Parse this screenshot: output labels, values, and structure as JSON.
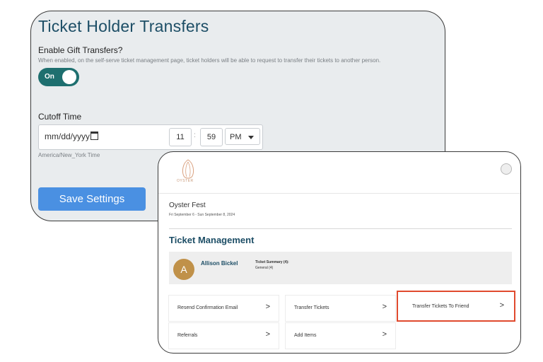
{
  "settings": {
    "title": "Ticket Holder Transfers",
    "enable_label": "Enable Gift Transfers?",
    "enable_help": "When enabled, on the self-serve ticket management page, ticket holders will be able to request to transfer their tickets to another person.",
    "toggle_label": "On",
    "cutoff_label": "Cutoff Time",
    "date_placeholder": "mm/dd/yyyy",
    "hour": "11",
    "colon": ":",
    "minute": "59",
    "ampm": "PM",
    "timezone": "America/New_York Time",
    "save_label": "Save Settings",
    "colors": {
      "accent": "#1d4e66",
      "toggle": "#1e6f6f",
      "button": "#4a90e2"
    }
  },
  "ticket_management": {
    "logo_text": "OYSTER",
    "event_name": "Oyster Fest",
    "event_dates": "Fri September 6 - Sun September 8, 2024",
    "section_title": "Ticket Management",
    "holder": {
      "initial": "A",
      "name": "Allison Bickel",
      "summary_label": "Ticket Summary (4):",
      "summary_detail": "General (4)"
    },
    "actions": [
      {
        "label": "Resend Confirmation Email",
        "chevron": ">"
      },
      {
        "label": "Transfer Tickets",
        "chevron": ">"
      },
      {
        "label": "Transfer Tickets To Friend",
        "chevron": ">"
      },
      {
        "label": "Referrals",
        "chevron": ">"
      },
      {
        "label": "Add Items",
        "chevron": ">"
      }
    ],
    "colors": {
      "highlight": "#e04a2e",
      "avatar": "#c09149"
    }
  }
}
